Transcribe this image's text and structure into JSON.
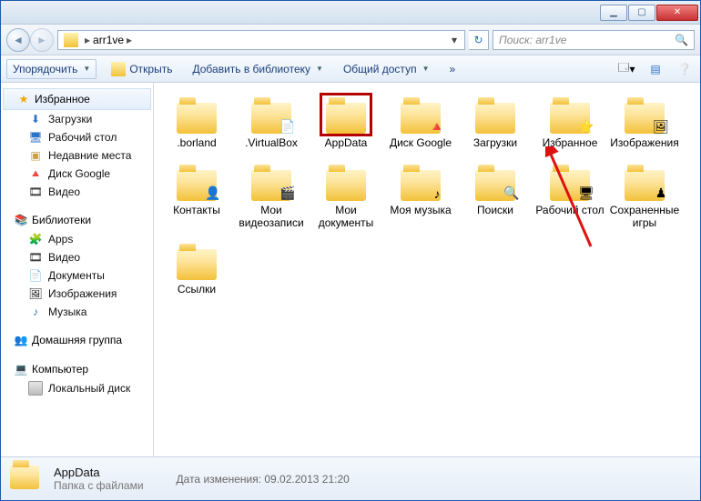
{
  "titlebar": {},
  "nav": {
    "path_root": "arr1ve",
    "search_placeholder": "Поиск: arr1ve"
  },
  "toolbar": {
    "organize": "Упорядочить",
    "open": "Открыть",
    "addlib": "Добавить в библиотеку",
    "share": "Общий доступ",
    "tooltip_views": "",
    "tooltip_help": ""
  },
  "sidebar": {
    "favorites": {
      "label": "Избранное",
      "items": [
        {
          "label": "Загрузки",
          "icon": "download-icon"
        },
        {
          "label": "Рабочий стол",
          "icon": "desktop-icon"
        },
        {
          "label": "Недавние места",
          "icon": "recent-icon"
        },
        {
          "label": "Диск Google",
          "icon": "googledrive-icon"
        },
        {
          "label": "Видео",
          "icon": "video-icon"
        }
      ]
    },
    "libraries": {
      "label": "Библиотеки",
      "items": [
        {
          "label": "Apps",
          "icon": "apps-icon"
        },
        {
          "label": "Видео",
          "icon": "video-icon"
        },
        {
          "label": "Документы",
          "icon": "documents-icon"
        },
        {
          "label": "Изображения",
          "icon": "images-icon"
        },
        {
          "label": "Музыка",
          "icon": "music-icon"
        }
      ]
    },
    "homegroup": {
      "label": "Домашняя группа"
    },
    "computer": {
      "label": "Компьютер",
      "items": [
        {
          "label": "Локальный диск",
          "icon": "drive-icon"
        }
      ]
    }
  },
  "items": [
    {
      "label": ".borland",
      "overlay": null
    },
    {
      "label": ".VirtualBox",
      "overlay": "page"
    },
    {
      "label": "AppData",
      "overlay": null,
      "selected": true
    },
    {
      "label": "Диск Google",
      "overlay": "gdrive"
    },
    {
      "label": "Загрузки",
      "overlay": null
    },
    {
      "label": "Избранное",
      "overlay": "star"
    },
    {
      "label": "Изображения",
      "overlay": "image"
    },
    {
      "label": "Контакты",
      "overlay": "contact"
    },
    {
      "label": "Мои видеозаписи",
      "overlay": "film"
    },
    {
      "label": "Мои документы",
      "overlay": null
    },
    {
      "label": "Моя музыка",
      "overlay": "music"
    },
    {
      "label": "Поиски",
      "overlay": "search"
    },
    {
      "label": "Рабочий стол",
      "overlay": "desk"
    },
    {
      "label": "Сохраненные игры",
      "overlay": "game"
    },
    {
      "label": "Ссылки",
      "overlay": null
    }
  ],
  "status": {
    "name": "AppData",
    "type": "Папка с файлами",
    "mod_label": "Дата изменения:",
    "mod_value": "09.02.2013 21:20"
  }
}
